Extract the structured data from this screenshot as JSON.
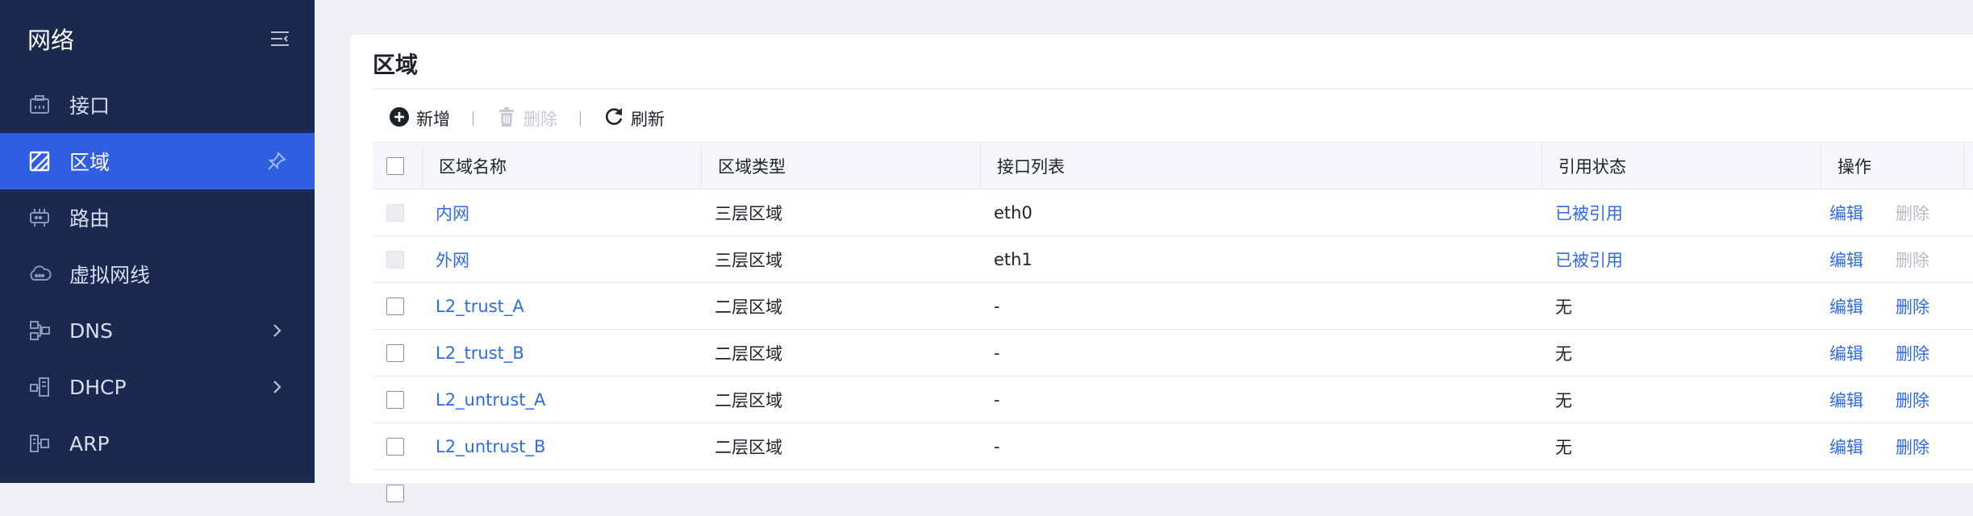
{
  "sidebar": {
    "title": "网络",
    "items": [
      {
        "label": "接口",
        "icon": "interface-icon",
        "active": false
      },
      {
        "label": "区域",
        "icon": "zone-icon",
        "active": true
      },
      {
        "label": "路由",
        "icon": "router-icon",
        "active": false
      },
      {
        "label": "虚拟网线",
        "icon": "cloud-link-icon",
        "active": false
      },
      {
        "label": "DNS",
        "icon": "dns-icon",
        "active": false,
        "expandable": true
      },
      {
        "label": "DHCP",
        "icon": "dhcp-icon",
        "active": false,
        "expandable": true
      },
      {
        "label": "ARP",
        "icon": "arp-icon",
        "active": false
      }
    ]
  },
  "panel": {
    "title": "区域"
  },
  "toolbar": {
    "add_label": "新增",
    "delete_label": "删除",
    "refresh_label": "刷新"
  },
  "table": {
    "columns": [
      "区域名称",
      "区域类型",
      "接口列表",
      "引用状态",
      "操作"
    ],
    "rows": [
      {
        "name": "内网",
        "type": "三层区域",
        "interfaces": "eth0",
        "ref": "已被引用",
        "ref_link": true,
        "edit": "编辑",
        "delete": "删除",
        "delete_enabled": false,
        "selectable": false
      },
      {
        "name": "外网",
        "type": "三层区域",
        "interfaces": "eth1",
        "ref": "已被引用",
        "ref_link": true,
        "edit": "编辑",
        "delete": "删除",
        "delete_enabled": false,
        "selectable": false
      },
      {
        "name": "L2_trust_A",
        "type": "二层区域",
        "interfaces": "-",
        "ref": "无",
        "ref_link": false,
        "edit": "编辑",
        "delete": "删除",
        "delete_enabled": true,
        "selectable": true
      },
      {
        "name": "L2_trust_B",
        "type": "二层区域",
        "interfaces": "-",
        "ref": "无",
        "ref_link": false,
        "edit": "编辑",
        "delete": "删除",
        "delete_enabled": true,
        "selectable": true
      },
      {
        "name": "L2_untrust_A",
        "type": "二层区域",
        "interfaces": "-",
        "ref": "无",
        "ref_link": false,
        "edit": "编辑",
        "delete": "删除",
        "delete_enabled": true,
        "selectable": true
      },
      {
        "name": "L2_untrust_B",
        "type": "二层区域",
        "interfaces": "-",
        "ref": "无",
        "ref_link": false,
        "edit": "编辑",
        "delete": "删除",
        "delete_enabled": true,
        "selectable": true
      }
    ]
  },
  "colors": {
    "sidebar_bg": "#1b2950",
    "active_bg": "#2f5fe0",
    "link": "#2f6be8"
  }
}
